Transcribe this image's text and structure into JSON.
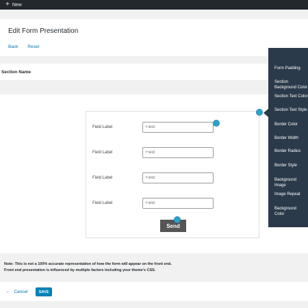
{
  "topbar": {
    "new_label": "New",
    "plus_glyph": "+"
  },
  "header": {
    "title": "Edit Form Presentation",
    "back_label": "Back",
    "reset_label": "Reset"
  },
  "section": {
    "name": "Section Name"
  },
  "form": {
    "fields": [
      {
        "label": "Field Label",
        "placeholder": "Field"
      },
      {
        "label": "Field Label",
        "placeholder": "Field"
      },
      {
        "label": "Field Label",
        "placeholder": "Field"
      },
      {
        "label": "Field Label",
        "placeholder": "Field"
      }
    ],
    "send_label": "Send"
  },
  "popover": {
    "items": [
      {
        "line1": "Form Padding",
        "line2": ""
      },
      {
        "line1": "Section",
        "line2": "Background Color"
      },
      {
        "line1": "Section Text Color",
        "line2": ""
      },
      {
        "line1": "Section Text Style",
        "line2": ""
      },
      {
        "line1": "Border Color",
        "line2": ""
      },
      {
        "line1": "Border Width",
        "line2": ""
      },
      {
        "line1": "Border Radius",
        "line2": ""
      },
      {
        "line1": "Border Style",
        "line2": ""
      },
      {
        "line1": "Background",
        "line2": "Image"
      },
      {
        "line1": "Image Repeat",
        "line2": ""
      },
      {
        "line1": "Background",
        "line2": "Color"
      }
    ]
  },
  "notice": {
    "line1": "Note: This is not a 100% accurate representation of how the form will appear on the front end.",
    "line2": "Front end presentation is influenced by multiple factors including your theme's CSS."
  },
  "footer": {
    "cancel_label": "Cancel",
    "cancel_arrow": "←",
    "save_label": "SAVE"
  },
  "colors": {
    "accent": "#0085ba",
    "link": "#0073aa",
    "hotspot": "#2ea2cc",
    "popover_bg": "#2b3a4a",
    "topbar_bg": "#23282d"
  }
}
